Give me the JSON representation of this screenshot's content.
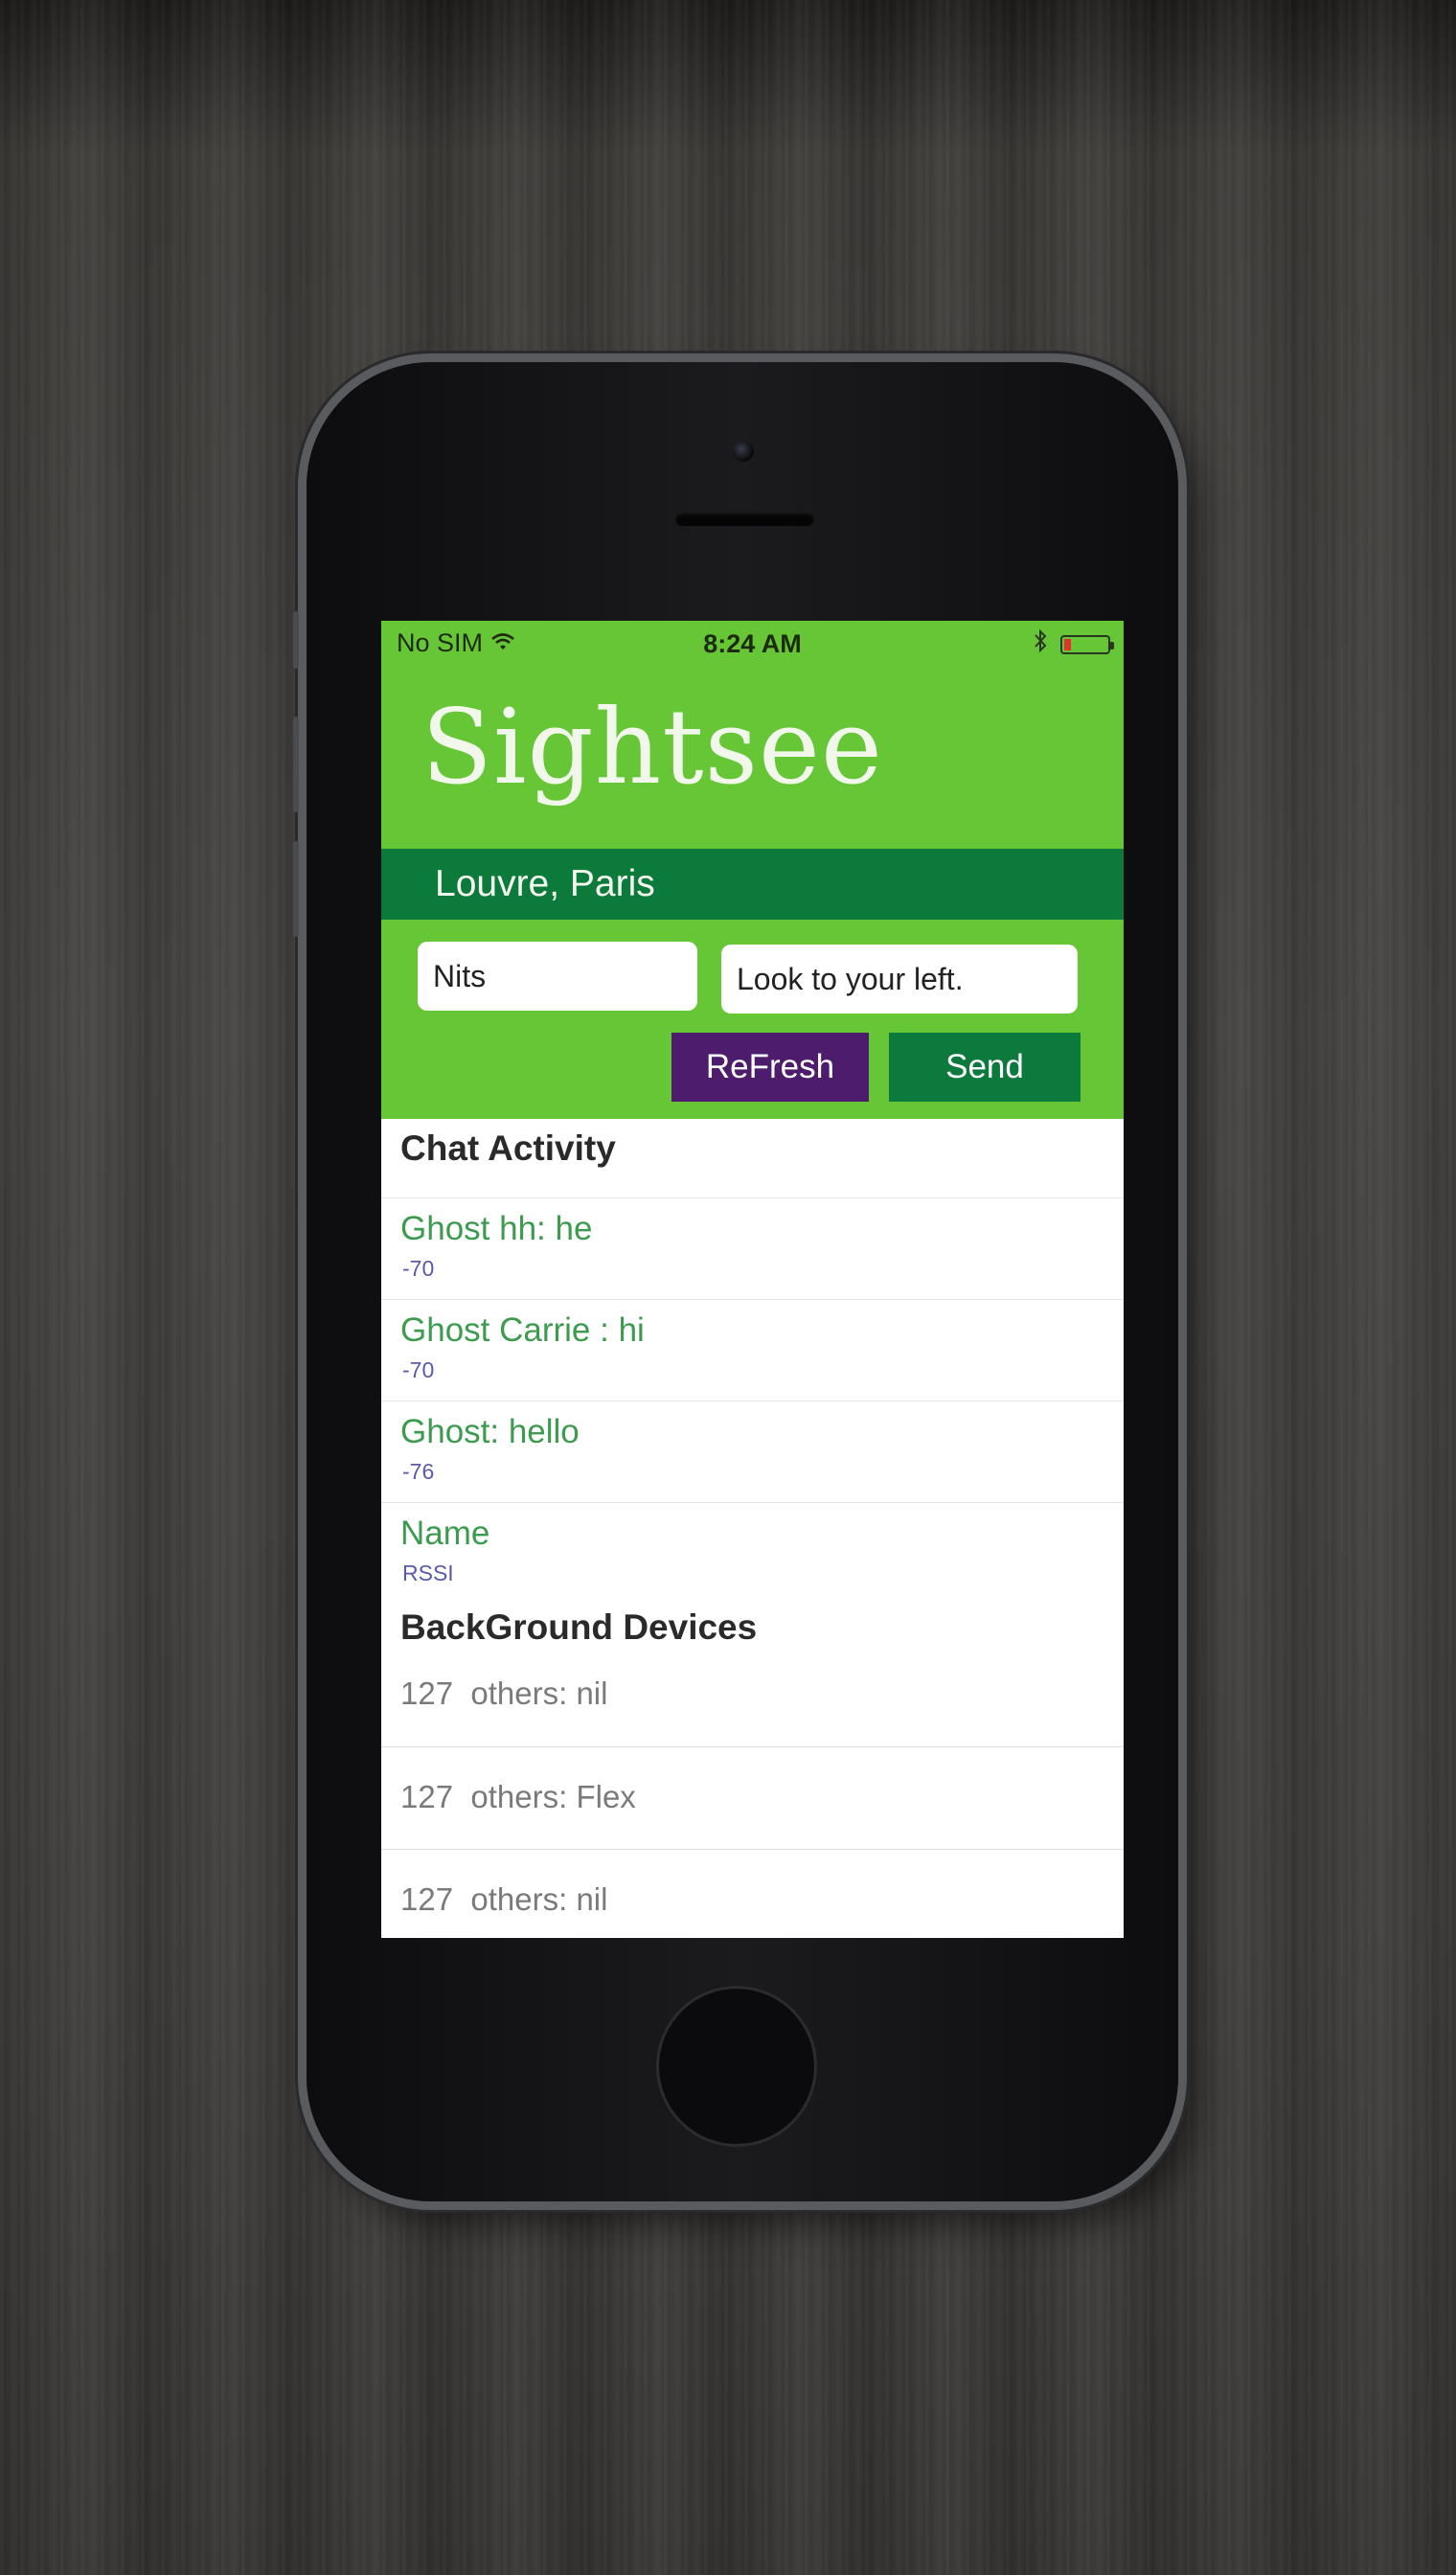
{
  "status_bar": {
    "carrier": "No SIM",
    "time": "8:24 AM",
    "battery_level": 0.15,
    "battery_color": "#e0322c"
  },
  "app": {
    "title": "Sightsee",
    "location": "Louvre, Paris",
    "header_color": "#66c636",
    "location_bar_color": "#0b7a3a"
  },
  "form": {
    "name_value": "Nits",
    "message_value": "Look to your left.",
    "refresh_label": "ReFresh",
    "send_label": "Send",
    "refresh_color": "#4d1c6c",
    "send_color": "#0d7a3d"
  },
  "chat": {
    "header": "Chat Activity",
    "rows": [
      {
        "title": "Ghost hh: he",
        "subtitle": "-70"
      },
      {
        "title": "Ghost Carrie : hi",
        "subtitle": "-70"
      },
      {
        "title": "Ghost: hello",
        "subtitle": "-76"
      },
      {
        "title": "Name",
        "subtitle": "RSSI"
      }
    ]
  },
  "devices": {
    "header": "BackGround Devices",
    "rows": [
      {
        "text": "127  others: nil"
      },
      {
        "text": "127  others: Flex"
      },
      {
        "text": "127  others: nil"
      }
    ]
  },
  "icons": [
    "wifi-icon",
    "bluetooth-icon",
    "battery-icon"
  ]
}
